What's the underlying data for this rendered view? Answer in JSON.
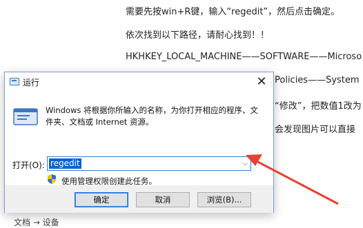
{
  "article": {
    "line1": "需要先按win+R键，输入“regedit”，然后点击确定。",
    "line2": "依次找到以下路径，请耐心找到！！",
    "line3": "HKHKEY_LOCAL_MACHINE——SOFTWARE——Microso",
    "line4": "Policies——System",
    "line5": "“修改”，把数值1改为",
    "line6": "会发现图片可以直接",
    "footer": "文档 → 设备"
  },
  "dialog": {
    "title": "运行",
    "close_glyph": "✕",
    "description": "Windows 将根据你所输入的名称，为你打开相应的程序、文件夹、文档或 Internet 资源。",
    "open_label": "打开(O):",
    "input_value": "regedit",
    "admin_text": "使用管理权限创建此任务。",
    "buttons": {
      "ok": "确定",
      "cancel": "取消",
      "browse": "浏览(B)..."
    }
  },
  "colors": {
    "accent": "#0a64d0",
    "arrow": "#e8412e"
  }
}
